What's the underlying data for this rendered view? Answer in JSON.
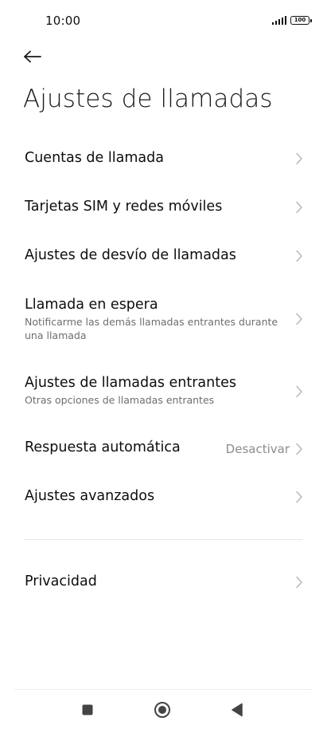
{
  "status_bar": {
    "time": "10:00",
    "battery": "100"
  },
  "header": {
    "back_icon": "arrow-left-icon",
    "title": "Ajustes de llamadas"
  },
  "items": [
    {
      "title": "Cuentas de llamada"
    },
    {
      "title": "Tarjetas SIM y redes móviles"
    },
    {
      "title": "Ajustes de desvío de llamadas"
    },
    {
      "title": "Llamada en espera",
      "subtitle": "Notificarme las demás llamadas entrantes durante una llamada"
    },
    {
      "title": "Ajustes de llamadas entrantes",
      "subtitle": "Otras opciones de llamadas entrantes"
    },
    {
      "title": "Respuesta automática",
      "value": "Desactivar"
    },
    {
      "title": "Ajustes avanzados"
    },
    {
      "title": "Privacidad"
    }
  ],
  "nav_bar": {
    "recents_icon": "square-icon",
    "home_icon": "circle-icon",
    "back_icon": "triangle-back-icon"
  },
  "colors": {
    "background": "#ffffff",
    "title_text": "#0d0d0d",
    "secondary_text": "#6e6e6e",
    "chevron": "#b5b5b5",
    "nav_icons": "#444444"
  }
}
